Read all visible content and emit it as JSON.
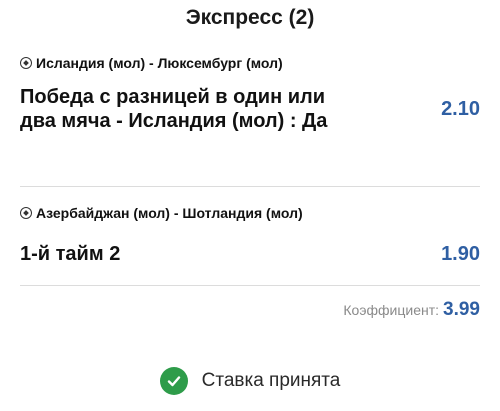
{
  "header": {
    "title": "Экспресс (2)"
  },
  "bets": [
    {
      "match": "Исландия (мол) - Люксембург (мол)",
      "selection": "Победа с разницей в один или два мяча - Исландия (мол) : Да",
      "odd": "2.10"
    },
    {
      "match": "Азербайджан (мол) - Шотландия (мол)",
      "selection": "1-й тайм 2",
      "odd": "1.90"
    }
  ],
  "summary": {
    "coef_label": "Коэффициент:",
    "coef_value": "3.99"
  },
  "status": {
    "text": "Ставка принята",
    "icon": "check-circle-icon"
  },
  "colors": {
    "odd": "#2f5fa3",
    "success": "#2e9c4a",
    "divider": "#dcdcdc"
  }
}
